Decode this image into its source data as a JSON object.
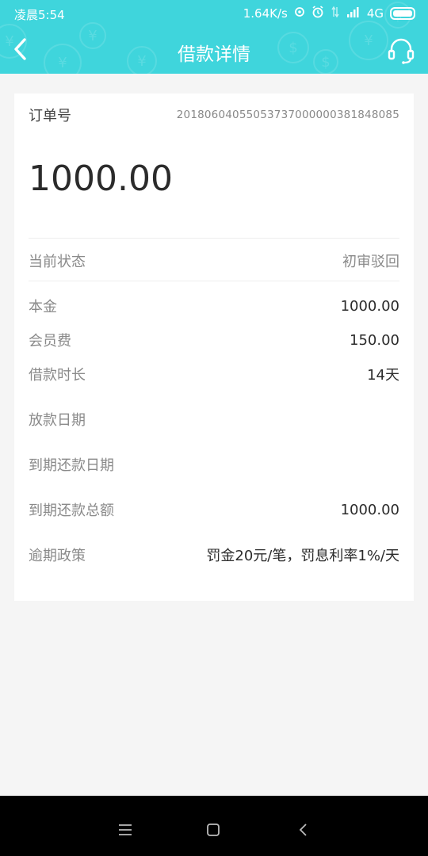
{
  "status_bar": {
    "time": "凌晨5:54",
    "speed": "1.64K/s",
    "network": "4G"
  },
  "header": {
    "title": "借款详情"
  },
  "order": {
    "label": "订单号",
    "number": "20180604055053737000000381848085"
  },
  "amount": "1000.00",
  "status": {
    "label": "当前状态",
    "value": "初审驳回"
  },
  "details": [
    {
      "label": "本金",
      "value": "1000.00"
    },
    {
      "label": "会员费",
      "value": "150.00"
    },
    {
      "label": "借款时长",
      "value": "14天"
    },
    {
      "label": "放款日期",
      "value": ""
    },
    {
      "label": "到期还款日期",
      "value": ""
    },
    {
      "label": "到期还款总额",
      "value": "1000.00"
    },
    {
      "label": "逾期政策",
      "value": "罚金20元/笔，罚息利率1%/天"
    }
  ],
  "colors": {
    "header": "#3fd5dc",
    "background": "#f5f5f5"
  }
}
